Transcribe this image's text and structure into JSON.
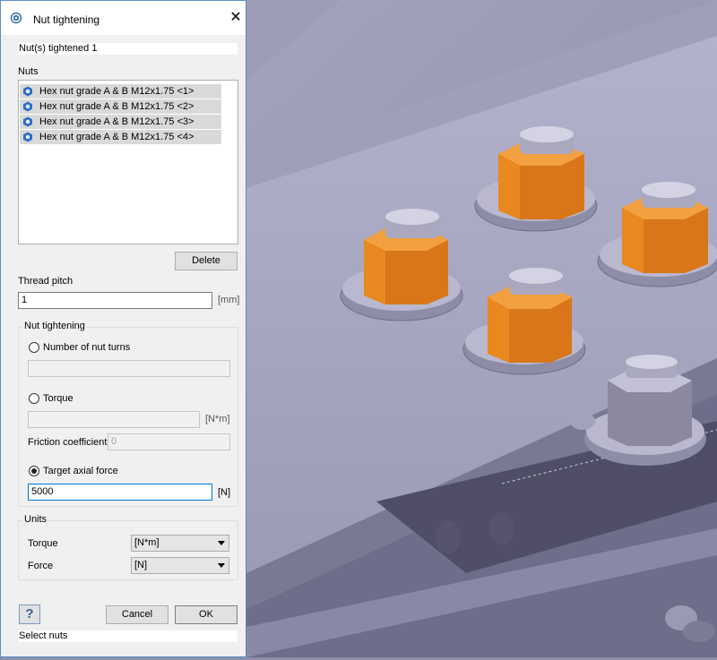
{
  "dialog": {
    "title": "Nut tightening",
    "info": "Nut(s) tightened 1",
    "nuts_label": "Nuts",
    "nuts": [
      "Hex nut grade A & B M12x1.75 <1>",
      "Hex nut grade A & B M12x1.75 <2>",
      "Hex nut grade A & B M12x1.75 <3>",
      "Hex nut grade A & B M12x1.75 <4>"
    ],
    "delete_label": "Delete",
    "thread_pitch_label": "Thread pitch",
    "thread_pitch_value": "1",
    "thread_pitch_unit": "[mm]",
    "nut_tightening": {
      "title": "Nut tightening",
      "turns_label": "Number of nut turns",
      "turns_value": "",
      "torque_label": "Torque",
      "torque_value": "",
      "torque_unit": "[N*m]",
      "friction_label": "Friction coefficient",
      "friction_value": "0",
      "axial_label": "Target axial force",
      "axial_value": "5000",
      "axial_unit": "[N]",
      "selected": "Target axial force"
    },
    "units": {
      "title": "Units",
      "torque_label": "Torque",
      "torque_value": "[N*m]",
      "force_label": "Force",
      "force_value": "[N]"
    },
    "help_label": "?",
    "cancel_label": "Cancel",
    "ok_label": "OK",
    "status": "Select nuts"
  },
  "colors": {
    "accent": "#0078d7",
    "nut_highlight": "#f08a1c",
    "model_steel": "#a8a7c0"
  }
}
